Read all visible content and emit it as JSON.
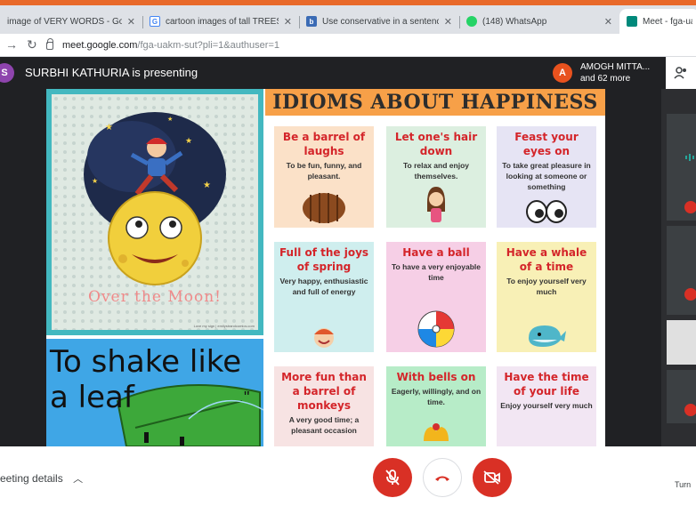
{
  "browser": {
    "tabs": [
      {
        "title": "image of VERY WORDS - Google",
        "favicon": "google-favicon",
        "color": "#4285f4"
      },
      {
        "title": "cartoon images of tall TREES - G",
        "favicon": "google-favicon",
        "color": "#4285f4"
      },
      {
        "title": "Use conservative in a sentence |",
        "favicon": "dictionary-favicon",
        "color": "#3b6bb5"
      },
      {
        "title": "(148) WhatsApp",
        "favicon": "whatsapp-favicon",
        "color": "#25d366"
      },
      {
        "title": "Meet - fga-uak",
        "favicon": "meet-favicon",
        "color": "#00897b"
      }
    ],
    "url_host": "meet.google.com",
    "url_rest": "/fga-uakm-sut?pli=1&authuser=1"
  },
  "meet": {
    "presenter_initial": "S",
    "presenter_color": "#8e44ad",
    "presenting_text": "SURBHI KATHURIA is presenting",
    "user_initial": "A",
    "user_color": "#e8521e",
    "user_name": "AMOGH MITTA...",
    "others_count": "and 62 more"
  },
  "slide": {
    "moon_caption": "Over the Moon!",
    "moon_credit": "Love my sign | emilystrandcomics.com",
    "shake_text": "To shake like a leaf",
    "header": "IDIOMS ABOUT HAPPINESS",
    "cards": [
      {
        "title": "Be a barrel of laughs",
        "desc": "To be fun, funny, and pleasant.",
        "bg": "#fbe1c8"
      },
      {
        "title": "Let one's hair down",
        "desc": "To relax and enjoy themselves.",
        "bg": "#dcefe0"
      },
      {
        "title": "Feast your eyes on",
        "desc": "To take great pleasure in looking at someone or something",
        "bg": "#e6e4f4"
      },
      {
        "title": "Full of the joys of spring",
        "desc": "Very happy, enthusiastic and full of energy",
        "bg": "#cfeeee"
      },
      {
        "title": "Have a ball",
        "desc": "To have a very enjoyable time",
        "bg": "#f6cfe6"
      },
      {
        "title": "Have a whale of a time",
        "desc": "To enjoy yourself very much",
        "bg": "#f8f0b6"
      },
      {
        "title": "More fun than a barrel of monkeys",
        "desc": "A very good time; a pleasant occasion",
        "bg": "#f7e3e3"
      },
      {
        "title": "With bells on",
        "desc": "Eagerly, willingly, and on time.",
        "bg": "#b7ecc8"
      },
      {
        "title": "Have the time of your life",
        "desc": "Enjoy yourself very much",
        "bg": "#f2e6f3"
      }
    ]
  },
  "controls": {
    "meeting_details": "eeting details",
    "turn_text": "Turn"
  }
}
